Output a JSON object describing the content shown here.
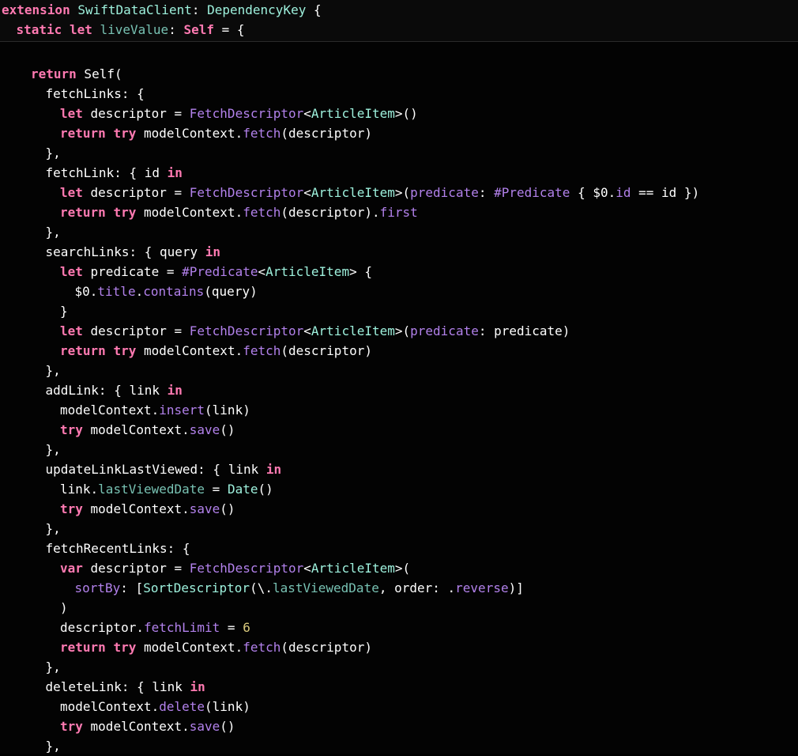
{
  "colors": {
    "background": "#030303",
    "sticky_background": "#0a0a0a",
    "keyword": "#ff7ab2",
    "type": "#9ef1dd",
    "method": "#b281eb",
    "property": "#78c2b3",
    "number": "#d9c97c",
    "plain": "#ffffff"
  },
  "sticky_header": [
    {
      "indent": 0,
      "tokens": [
        [
          "kw",
          "extension"
        ],
        [
          "pl",
          " "
        ],
        [
          "ty",
          "SwiftDataClient"
        ],
        [
          "pl",
          ": "
        ],
        [
          "ty",
          "DependencyKey"
        ],
        [
          "pl",
          " {"
        ]
      ]
    },
    {
      "indent": 1,
      "tokens": [
        [
          "kw",
          "static"
        ],
        [
          "pl",
          " "
        ],
        [
          "kw",
          "let"
        ],
        [
          "pl",
          " "
        ],
        [
          "prop",
          "liveValue"
        ],
        [
          "pl",
          ": "
        ],
        [
          "kw",
          "Self"
        ],
        [
          "pl",
          " = {"
        ]
      ]
    }
  ],
  "code_lines": [
    {
      "indent": 2,
      "tokens": [
        [
          "kw",
          "return"
        ],
        [
          "pl",
          " Self("
        ]
      ]
    },
    {
      "indent": 3,
      "tokens": [
        [
          "pl",
          "fetchLinks: {"
        ]
      ]
    },
    {
      "indent": 4,
      "tokens": [
        [
          "kw",
          "let"
        ],
        [
          "pl",
          " descriptor = "
        ],
        [
          "mth",
          "FetchDescriptor"
        ],
        [
          "pl",
          "<"
        ],
        [
          "ty",
          "ArticleItem"
        ],
        [
          "pl",
          ">()"
        ]
      ]
    },
    {
      "indent": 4,
      "tokens": [
        [
          "kw",
          "return"
        ],
        [
          "pl",
          " "
        ],
        [
          "kw",
          "try"
        ],
        [
          "pl",
          " modelContext."
        ],
        [
          "mth",
          "fetch"
        ],
        [
          "pl",
          "(descriptor)"
        ]
      ]
    },
    {
      "indent": 3,
      "tokens": [
        [
          "pl",
          "},"
        ]
      ]
    },
    {
      "indent": 3,
      "tokens": [
        [
          "pl",
          "fetchLink: { id "
        ],
        [
          "kw",
          "in"
        ]
      ]
    },
    {
      "indent": 4,
      "tokens": [
        [
          "kw",
          "let"
        ],
        [
          "pl",
          " descriptor = "
        ],
        [
          "mth",
          "FetchDescriptor"
        ],
        [
          "pl",
          "<"
        ],
        [
          "ty",
          "ArticleItem"
        ],
        [
          "pl",
          ">("
        ],
        [
          "mth",
          "predicate"
        ],
        [
          "pl",
          ": "
        ],
        [
          "mth",
          "#Predicate"
        ],
        [
          "pl",
          " { $0."
        ],
        [
          "mth",
          "id"
        ],
        [
          "pl",
          " == id })"
        ]
      ]
    },
    {
      "indent": 4,
      "tokens": [
        [
          "kw",
          "return"
        ],
        [
          "pl",
          " "
        ],
        [
          "kw",
          "try"
        ],
        [
          "pl",
          " modelContext."
        ],
        [
          "mth",
          "fetch"
        ],
        [
          "pl",
          "(descriptor)."
        ],
        [
          "mth",
          "first"
        ]
      ]
    },
    {
      "indent": 3,
      "tokens": [
        [
          "pl",
          "},"
        ]
      ]
    },
    {
      "indent": 3,
      "tokens": [
        [
          "pl",
          "searchLinks: { query "
        ],
        [
          "kw",
          "in"
        ]
      ]
    },
    {
      "indent": 4,
      "tokens": [
        [
          "kw",
          "let"
        ],
        [
          "pl",
          " predicate = "
        ],
        [
          "mth",
          "#Predicate"
        ],
        [
          "pl",
          "<"
        ],
        [
          "ty",
          "ArticleItem"
        ],
        [
          "pl",
          "> {"
        ]
      ]
    },
    {
      "indent": 5,
      "tokens": [
        [
          "pl",
          "$0."
        ],
        [
          "mth",
          "title"
        ],
        [
          "pl",
          "."
        ],
        [
          "mth",
          "contains"
        ],
        [
          "pl",
          "(query)"
        ]
      ]
    },
    {
      "indent": 4,
      "tokens": [
        [
          "pl",
          "}"
        ]
      ]
    },
    {
      "indent": 4,
      "tokens": [
        [
          "kw",
          "let"
        ],
        [
          "pl",
          " descriptor = "
        ],
        [
          "mth",
          "FetchDescriptor"
        ],
        [
          "pl",
          "<"
        ],
        [
          "ty",
          "ArticleItem"
        ],
        [
          "pl",
          ">("
        ],
        [
          "mth",
          "predicate"
        ],
        [
          "pl",
          ": predicate)"
        ]
      ]
    },
    {
      "indent": 4,
      "tokens": [
        [
          "kw",
          "return"
        ],
        [
          "pl",
          " "
        ],
        [
          "kw",
          "try"
        ],
        [
          "pl",
          " modelContext."
        ],
        [
          "mth",
          "fetch"
        ],
        [
          "pl",
          "(descriptor)"
        ]
      ]
    },
    {
      "indent": 3,
      "tokens": [
        [
          "pl",
          "},"
        ]
      ]
    },
    {
      "indent": 3,
      "tokens": [
        [
          "pl",
          "addLink: { link "
        ],
        [
          "kw",
          "in"
        ]
      ]
    },
    {
      "indent": 4,
      "tokens": [
        [
          "pl",
          "modelContext."
        ],
        [
          "mth",
          "insert"
        ],
        [
          "pl",
          "(link)"
        ]
      ]
    },
    {
      "indent": 4,
      "tokens": [
        [
          "kw",
          "try"
        ],
        [
          "pl",
          " modelContext."
        ],
        [
          "mth",
          "save"
        ],
        [
          "pl",
          "()"
        ]
      ]
    },
    {
      "indent": 3,
      "tokens": [
        [
          "pl",
          "},"
        ]
      ]
    },
    {
      "indent": 3,
      "tokens": [
        [
          "pl",
          "updateLinkLastViewed: { link "
        ],
        [
          "kw",
          "in"
        ]
      ]
    },
    {
      "indent": 4,
      "tokens": [
        [
          "pl",
          "link."
        ],
        [
          "prop",
          "lastViewedDate"
        ],
        [
          "pl",
          " = "
        ],
        [
          "ty",
          "Date"
        ],
        [
          "pl",
          "()"
        ]
      ]
    },
    {
      "indent": 4,
      "tokens": [
        [
          "kw",
          "try"
        ],
        [
          "pl",
          " modelContext."
        ],
        [
          "mth",
          "save"
        ],
        [
          "pl",
          "()"
        ]
      ]
    },
    {
      "indent": 3,
      "tokens": [
        [
          "pl",
          "},"
        ]
      ]
    },
    {
      "indent": 3,
      "tokens": [
        [
          "pl",
          "fetchRecentLinks: {"
        ]
      ]
    },
    {
      "indent": 4,
      "tokens": [
        [
          "kw",
          "var"
        ],
        [
          "pl",
          " descriptor = "
        ],
        [
          "mth",
          "FetchDescriptor"
        ],
        [
          "pl",
          "<"
        ],
        [
          "ty",
          "ArticleItem"
        ],
        [
          "pl",
          ">("
        ]
      ]
    },
    {
      "indent": 5,
      "tokens": [
        [
          "mth",
          "sortBy"
        ],
        [
          "pl",
          ": ["
        ],
        [
          "ty",
          "SortDescriptor"
        ],
        [
          "pl",
          "(\\."
        ],
        [
          "prop",
          "lastViewedDate"
        ],
        [
          "pl",
          ", order: ."
        ],
        [
          "mth",
          "reverse"
        ],
        [
          "pl",
          ")]"
        ]
      ]
    },
    {
      "indent": 4,
      "tokens": [
        [
          "pl",
          ")"
        ]
      ]
    },
    {
      "indent": 4,
      "tokens": [
        [
          "pl",
          "descriptor."
        ],
        [
          "mth",
          "fetchLimit"
        ],
        [
          "pl",
          " = "
        ],
        [
          "num",
          "6"
        ]
      ]
    },
    {
      "indent": 4,
      "tokens": [
        [
          "kw",
          "return"
        ],
        [
          "pl",
          " "
        ],
        [
          "kw",
          "try"
        ],
        [
          "pl",
          " modelContext."
        ],
        [
          "mth",
          "fetch"
        ],
        [
          "pl",
          "(descriptor)"
        ]
      ]
    },
    {
      "indent": 3,
      "tokens": [
        [
          "pl",
          "},"
        ]
      ]
    },
    {
      "indent": 3,
      "tokens": [
        [
          "pl",
          "deleteLink: { link "
        ],
        [
          "kw",
          "in"
        ]
      ]
    },
    {
      "indent": 4,
      "tokens": [
        [
          "pl",
          "modelContext."
        ],
        [
          "mth",
          "delete"
        ],
        [
          "pl",
          "(link)"
        ]
      ]
    },
    {
      "indent": 4,
      "tokens": [
        [
          "kw",
          "try"
        ],
        [
          "pl",
          " modelContext."
        ],
        [
          "mth",
          "save"
        ],
        [
          "pl",
          "()"
        ]
      ]
    },
    {
      "indent": 3,
      "tokens": [
        [
          "pl",
          "},"
        ]
      ]
    }
  ]
}
